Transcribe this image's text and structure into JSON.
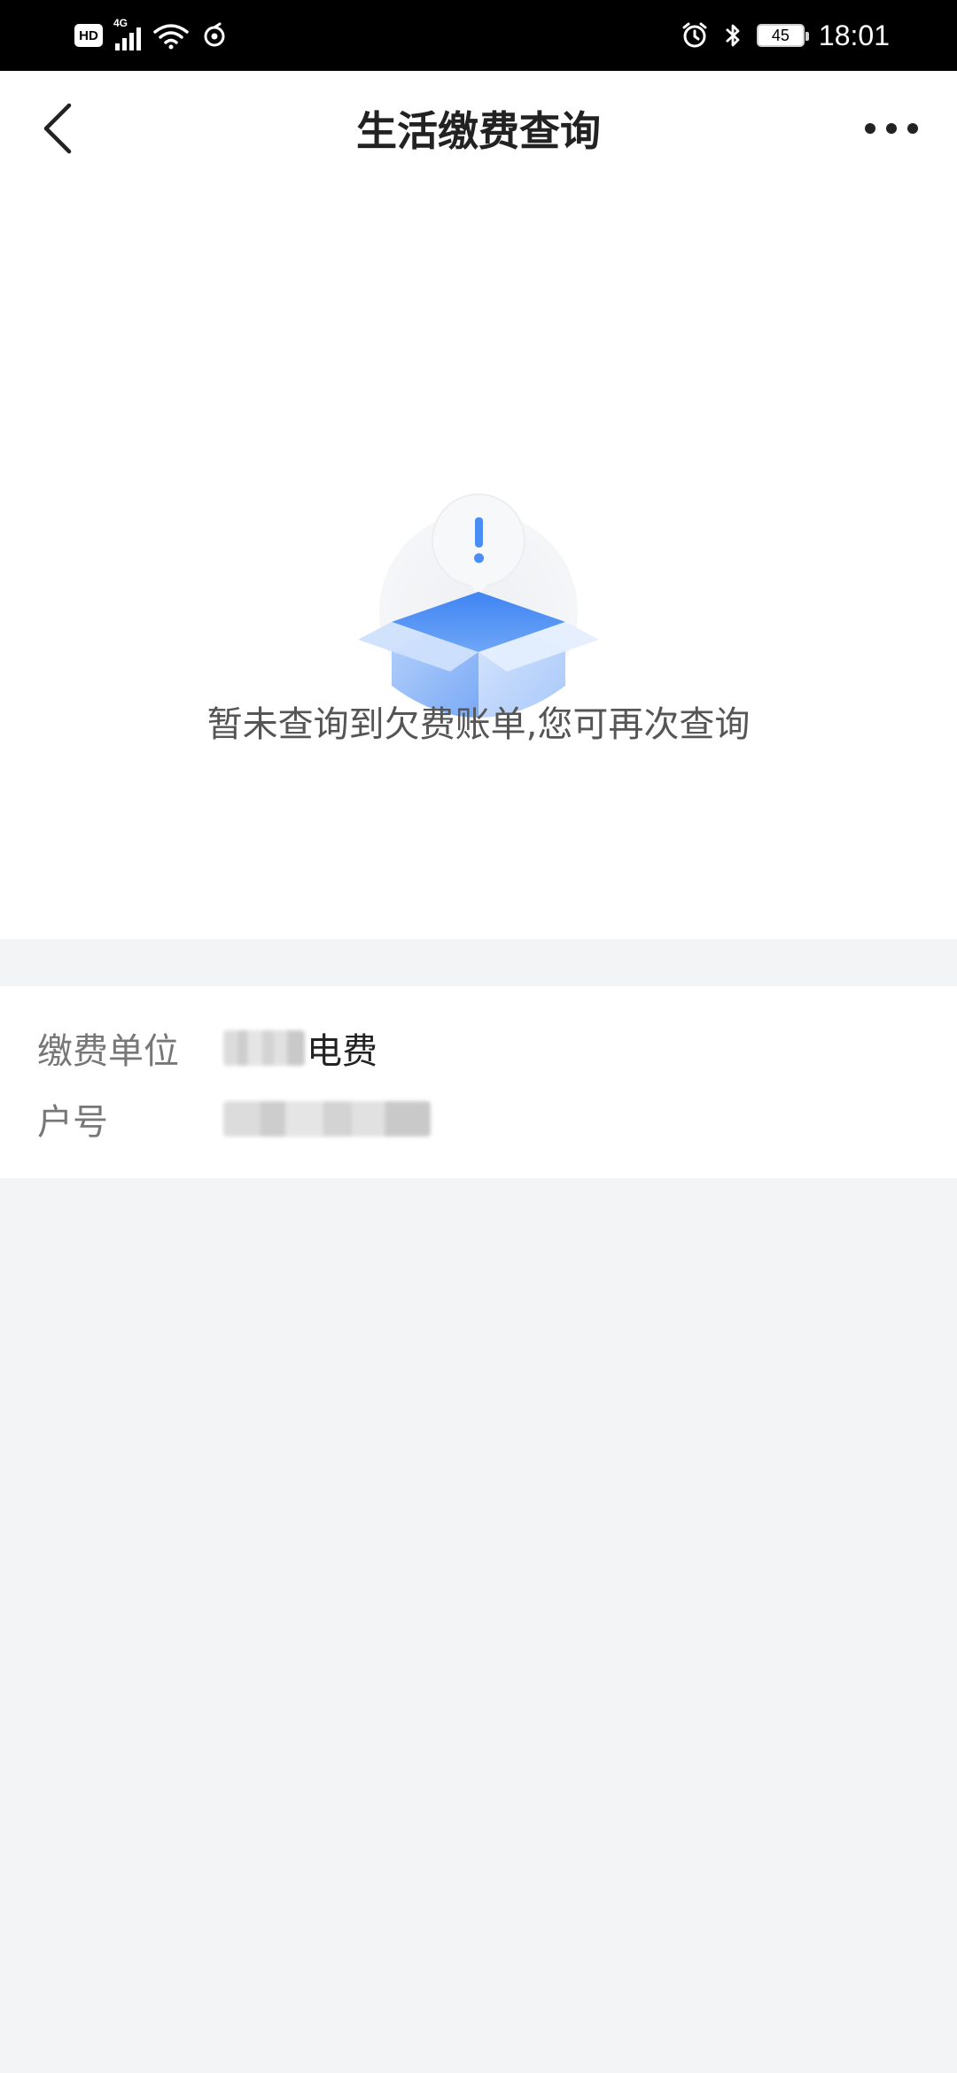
{
  "status_bar": {
    "network": "4G",
    "hd_label": "HD",
    "battery_level": "45",
    "time": "18:01",
    "icons": [
      "hd-icon",
      "signal-icon",
      "wifi-icon",
      "sync-icon",
      "alarm-icon",
      "bluetooth-icon",
      "battery-icon"
    ]
  },
  "header": {
    "title": "生活缴费查询",
    "back_icon": "chevron-left-icon",
    "more_icon": "more-horizontal-icon"
  },
  "empty_state": {
    "icon": "empty-box-alert-icon",
    "message": "暂未查询到欠费账单,您可再次查询",
    "accent_color": "#4a8ef5"
  },
  "bill_info": {
    "unit_label": "缴费单位",
    "unit_value_suffix": "电费",
    "account_label": "户号"
  }
}
